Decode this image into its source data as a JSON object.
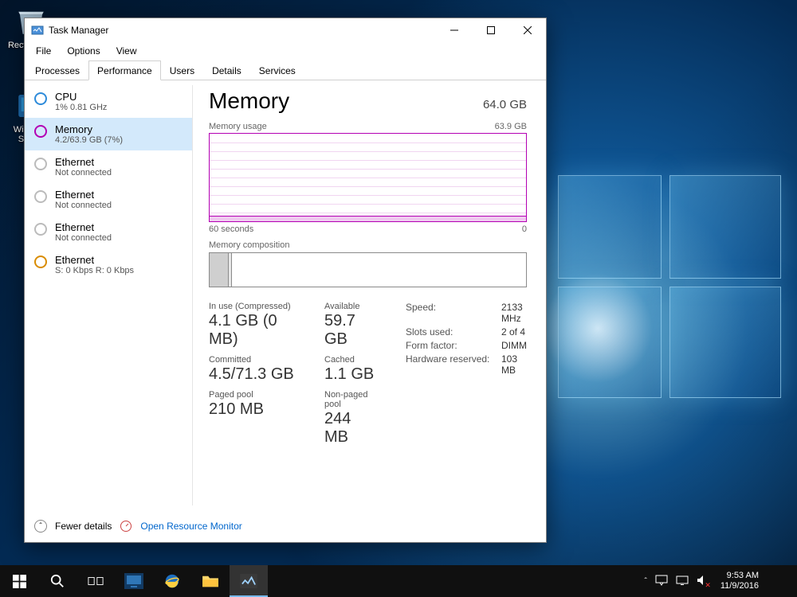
{
  "desktop": {
    "icons": [
      {
        "label": "Recycle Bin"
      },
      {
        "label": "Windows Server"
      }
    ]
  },
  "window": {
    "title": "Task Manager",
    "controls": {
      "min": "—",
      "max": "▢",
      "close": "✕"
    },
    "menu": [
      "File",
      "Options",
      "View"
    ],
    "tabs": [
      "Processes",
      "Performance",
      "Users",
      "Details",
      "Services"
    ],
    "active_tab": "Performance"
  },
  "sidebar": [
    {
      "name": "CPU",
      "sub": "1% 0.81 GHz",
      "kind": "cpu"
    },
    {
      "name": "Memory",
      "sub": "4.2/63.9 GB (7%)",
      "kind": "memory",
      "selected": true
    },
    {
      "name": "Ethernet",
      "sub": "Not connected",
      "kind": "eth"
    },
    {
      "name": "Ethernet",
      "sub": "Not connected",
      "kind": "eth"
    },
    {
      "name": "Ethernet",
      "sub": "Not connected",
      "kind": "eth"
    },
    {
      "name": "Ethernet",
      "sub": "S: 0 Kbps R: 0 Kbps",
      "kind": "eth",
      "orange": true
    }
  ],
  "main": {
    "heading": "Memory",
    "capacity": "64.0 GB",
    "graph": {
      "title": "Memory usage",
      "right": "63.9 GB",
      "x_left": "60 seconds",
      "x_right": "0"
    },
    "composition_label": "Memory composition",
    "stats_left": [
      {
        "label": "In use (Compressed)",
        "value": "4.1 GB (0 MB)"
      },
      {
        "label": "Committed",
        "value": "4.5/71.3 GB"
      },
      {
        "label": "Paged pool",
        "value": "210 MB"
      }
    ],
    "stats_mid": [
      {
        "label": "Available",
        "value": "59.7 GB"
      },
      {
        "label": "Cached",
        "value": "1.1 GB"
      },
      {
        "label": "Non-paged pool",
        "value": "244 MB"
      }
    ],
    "kv": [
      {
        "k": "Speed:",
        "v": "2133 MHz"
      },
      {
        "k": "Slots used:",
        "v": "2 of 4"
      },
      {
        "k": "Form factor:",
        "v": "DIMM"
      },
      {
        "k": "Hardware reserved:",
        "v": "103 MB"
      }
    ]
  },
  "footer": {
    "fewer": "Fewer details",
    "orm": "Open Resource Monitor"
  },
  "taskbar": {
    "time": "9:53 AM",
    "date": "11/9/2016"
  },
  "chart_data": {
    "type": "line",
    "title": "Memory usage",
    "xlabel": "seconds ago",
    "ylabel": "GB",
    "ylim": [
      0,
      63.9
    ],
    "x": [
      60,
      50,
      40,
      30,
      20,
      10,
      0
    ],
    "values": [
      4.2,
      4.2,
      4.2,
      4.2,
      4.2,
      4.2,
      4.2
    ]
  }
}
